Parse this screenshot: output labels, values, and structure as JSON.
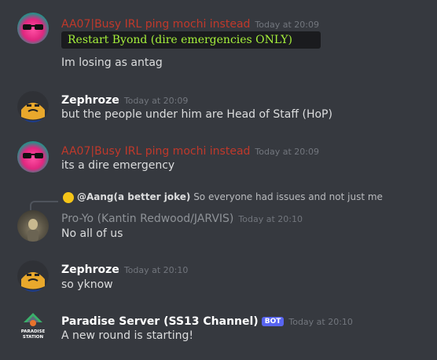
{
  "messages": [
    {
      "username": "AA07|Busy IRL ping mochi instead",
      "timestamp": "Today at 20:09",
      "code": "Restart Byond (dire emergencies ONLY)",
      "text": "Im losing as antag"
    },
    {
      "username": "Zephroze",
      "timestamp": "Today at 20:09",
      "text": "but the people under him are Head of Staff (HoP)"
    },
    {
      "username": "AA07|Busy IRL ping mochi instead",
      "timestamp": "Today at 20:09",
      "text": "its a dire emergency"
    },
    {
      "reply_to_name": "@Aang(a better joke)",
      "reply_to_text": "So everyone had issues and not just me",
      "username": "Pro-Yo (Kantin Redwood/JARVIS)",
      "timestamp": "Today at 20:10",
      "text": "No all of us"
    },
    {
      "username": "Zephroze",
      "timestamp": "Today at 20:10",
      "text": "so yknow"
    },
    {
      "username": "Paradise Server (SS13 Channel)",
      "badge": "BOT",
      "timestamp": "Today at 20:10",
      "text": "A new round is starting!",
      "avatar_caption": "PARADISE STATION"
    }
  ],
  "colors": {
    "background": "#36393f",
    "aa07_name": "#c0392b",
    "proyo_name": "#8e9297",
    "code_text": "#a6f13b",
    "bot_badge": "#5865f2"
  }
}
